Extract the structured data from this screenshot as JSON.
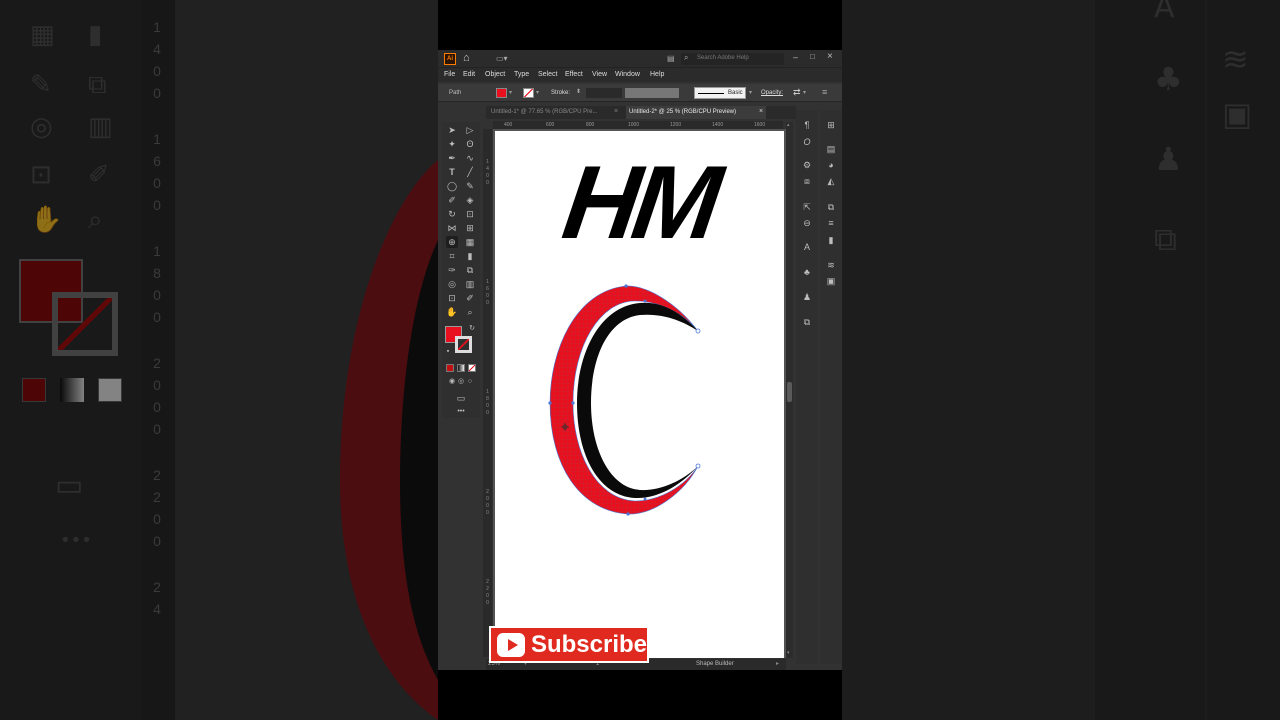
{
  "app": {
    "logo": "Ai",
    "search_placeholder": "Search Adobe Help"
  },
  "menu": [
    "File",
    "Edit",
    "Object",
    "Type",
    "Select",
    "Effect",
    "View",
    "Window",
    "Help"
  ],
  "control_bar": {
    "selection_type": "Path",
    "stroke_label": "Stroke:",
    "brush_label": "Basic",
    "opacity_label": "Opacity:"
  },
  "tabs": [
    {
      "label": "Untitled-1* @ 77.65 % (RGB/CPU Pre...",
      "active": false
    },
    {
      "label": "Untitled-2* @ 25 % (RGB/CPU Preview)",
      "active": true
    }
  ],
  "ruler_h_ticks": [
    "400",
    "600",
    "800",
    "1000",
    "1200",
    "1400",
    "1600"
  ],
  "ruler_v_ticks": [
    "1",
    "4",
    "0",
    "0",
    "1",
    "6",
    "0",
    "0",
    "1",
    "8",
    "0",
    "0",
    "2",
    "0",
    "0",
    "0",
    "2",
    "2",
    "0",
    "0"
  ],
  "artwork": {
    "heading": "HM"
  },
  "status": {
    "zoom": "25%",
    "artboard_number": "1",
    "active_tool": "Shape Builder"
  },
  "overlay": {
    "subscribe_label": "Subscribe"
  },
  "colors": {
    "fill": "#e8101f",
    "accent_red": "#e02a20",
    "selection_blue": "#4a78d6",
    "ui_dark": "#323232"
  },
  "background": {
    "left_ruler_digits": [
      "1",
      "4",
      "0",
      "0",
      "1",
      "6",
      "0",
      "0",
      "1",
      "8",
      "0",
      "0",
      "2",
      "0",
      "0",
      "0",
      "2",
      "2",
      "0",
      "0",
      "2",
      "4"
    ]
  }
}
